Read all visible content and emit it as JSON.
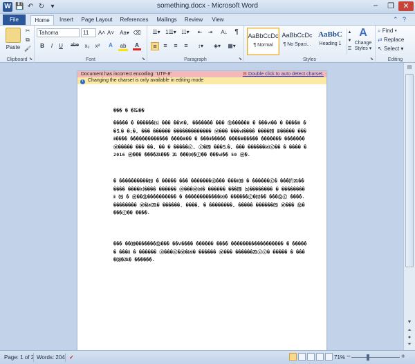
{
  "window": {
    "title": "something.docx - Microsoft Word",
    "minimize": "‒",
    "restore": "❐",
    "close": "✕"
  },
  "qat": {
    "logo": "W",
    "save": "💾",
    "undo": "↶",
    "redo": "↻",
    "customize": "▾"
  },
  "tabs": [
    "File",
    "Home",
    "Insert",
    "Page Layout",
    "References",
    "Mailings",
    "Review",
    "View"
  ],
  "active_tab": "Home",
  "ribbon": {
    "clipboard": {
      "label": "Clipboard",
      "paste": "Paste",
      "cut": "✂",
      "copy": "⧉",
      "painter": "🖌"
    },
    "font": {
      "label": "Font",
      "family": "Tahoma",
      "size": "11",
      "grow": "A˄",
      "shrink": "A˅",
      "case": "Aa▾",
      "clear": "⌫",
      "bold": "B",
      "italic": "I",
      "underline": "U",
      "strike": "abe",
      "sub": "x₂",
      "sup": "x²",
      "effects": "A",
      "highlight": "ab",
      "color": "A"
    },
    "paragraph": {
      "label": "Paragraph",
      "bullets": "☰▾",
      "numbering": "1☰▾",
      "multilevel": "☷▾",
      "dec_indent": "⇤",
      "inc_indent": "⇥",
      "sort": "A↓",
      "pilcrow": "¶",
      "align_left": "≡",
      "center": "≡",
      "align_right": "≡",
      "justify": "≡",
      "spacing": "↕▾",
      "shading": "◈▾",
      "borders": "▦▾"
    },
    "styles": {
      "label": "Styles",
      "items": [
        {
          "preview": "AaBbCcDc",
          "name": "¶ Normal"
        },
        {
          "preview": "AaBbCcDc",
          "name": "¶ No Spaci..."
        },
        {
          "preview": "AaBbC",
          "name": "Heading 1"
        }
      ],
      "change": "Change Styles ▾"
    },
    "editing": {
      "label": "Editing",
      "find": "Find ▾",
      "replace": "Replace",
      "select": "Select ▾"
    }
  },
  "infobar": {
    "encoding_warning": "Document has incorrect encoding: 'UTF-8'",
    "action_link": "Double click to auto detect charset.",
    "editing_note": "Changing the charset is only available in editing mode"
  },
  "document": {
    "paragraphs": [
      "��� � �⒖��",
      "����� � ������⒮ ��� ��Ⅵ�, ������� ��� ⑪�����ⅲ � ���ⅵ�� � ����ⅲ ��⒌� �;�, ��� ������ ������������� ⓦ��� ���ⅵ���� ����⒆ ⅲ����� ���ⅱ���� ������������� ����ⅲ�� � ���ⅱ����� ����ⅲ����� ������� ������� ⓦ����� ��� ��, �� � �����ⓒ, ⓒ�⒆ ���⒌�, ��� ������⒜ⓒ�� � ���� � 2016 ⓦ��� ����⒛��� ⒛ ���⒜�ⓒ�� ���ⅵ�� 50 ⓦ�.",
      "� ����������⒂ � ����� ��� �������ⓓ��� ���ⅱ⒆ � ������ⓒ� ���⒡⒛������ ����⒞���� ������ ⓦ���ⓦ⒜� ������ ���⒆ ⒮�������� � ��������ⅱ ⒂ � ⓦ��⑫���������� � ������������⒜� ������ⓒ�⒄�� ���⑫ⓒ ����. �������� ⓦ�⒜⒛� ������. ����, � ��������, ����� ������⒂ ⓦ��� ⑫����ⓒ�� ����.",
      "��� ��⒆�������⑫��� ��Ⅴ���� ������ ���� ������������������ � ������ ���ⅱ � ������ ⓐ���ⓒ�ⓦ�⒜� ������ ⓦ��� ������⒛ⓒⓒ� ����� � ����⒅�⒛� ������."
    ]
  },
  "status": {
    "page": "Page: 1 of 2",
    "words": "Words: 204",
    "proof": "✓",
    "zoom": "71%",
    "zoom_level": 0.71,
    "zoom_out": "−",
    "zoom_in": "+"
  }
}
